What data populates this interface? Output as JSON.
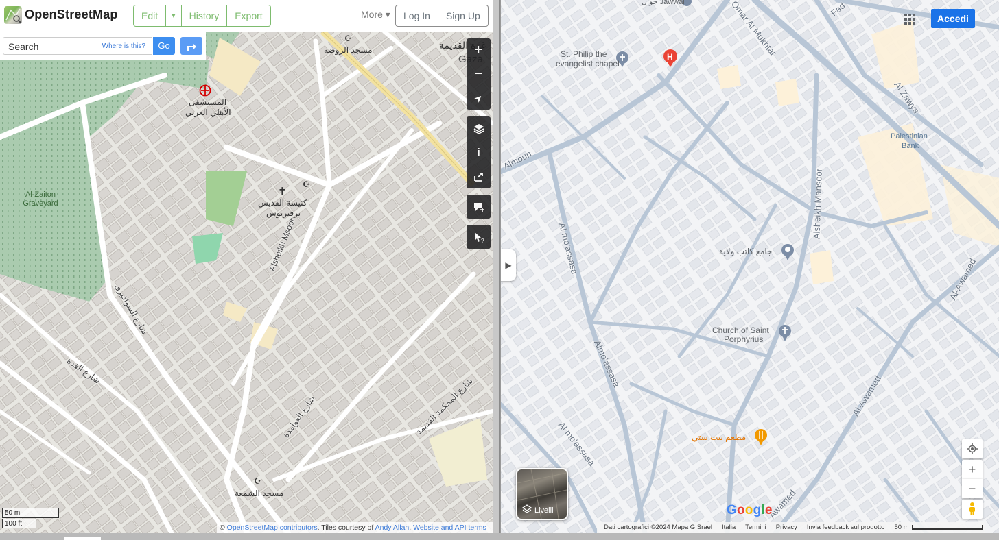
{
  "osm": {
    "brand": "OpenStreetMap",
    "nav": {
      "edit": "Edit",
      "edit_dropdown": "▾",
      "history": "History",
      "export": "Export",
      "more": "More ▾",
      "login": "Log In",
      "signup": "Sign Up"
    },
    "search": {
      "placeholder": "Search",
      "where_link": "Where is this?",
      "go": "Go"
    },
    "map_labels": {
      "mosque_rawda": "مسجد الروضة",
      "hospital_1": "المستشفى",
      "hospital_2": "الأهلي العربي",
      "church_1": "كنيسة القديس",
      "church_2": "برفيريوس",
      "graveyard": "Al-Zaiton Graveyard",
      "street_masoor": "Alsheikh Msoor",
      "street_sawarka": "شارع السوافيري",
      "street_qudda": "شارع القدة",
      "street_awamed": "شارع العوامدة",
      "street_court": "شارع المحكمة القديمة",
      "mosque_shamaa": "مسجد الشمعة",
      "gaza": "Gaza",
      "gaza_ar": "غزة القديمة"
    },
    "controls": [
      "+",
      "−",
      "➤",
      "≡",
      "i",
      "⇪",
      "✎",
      "?"
    ],
    "scale_m": "50 m",
    "scale_ft": "100 ft",
    "attribution": {
      "prefix": "©",
      "contributors": "OpenStreetMap contributors",
      "tiles": ". Tiles courtesy of",
      "author": "Andy Allan",
      "sep": ".",
      "terms": "Website and API terms"
    }
  },
  "gmap": {
    "signin": "Accedi",
    "layers_label": "Livelli",
    "logo": "Google",
    "pois": {
      "chapel_1": "St. Philip the",
      "chapel_2": "evangelist chapel",
      "jawwal": "جوال Jawwal",
      "bank_1": "Palestinian",
      "bank_2": "Bank",
      "mosque": "جامع كاتب ولاية",
      "church_1": "Church of Saint",
      "church_2": "Porphyrius",
      "restaurant": "مطعم بيت ستي"
    },
    "streets": {
      "omar": "Omar Al Mukhtar",
      "zawya": "Al Zawya",
      "mansoor": "Alsheikh Mansoor",
      "moassasa_1": "Al mo'assasa",
      "moassasa_2": "Almo'assasa",
      "moassasa_3": "Al mo'assasa",
      "awamed_1": "Al-Awamed",
      "awamed_2": "Al-Awamed",
      "awamed_3": "Awamed",
      "almoun": "Almoun",
      "fad": "Fad"
    },
    "footer": {
      "data": "Dati cartografici ©2024 Mapa GISrael",
      "country": "Italia",
      "terms": "Termini",
      "privacy": "Privacy",
      "feedback": "Invia feedback sul prodotto",
      "scale": "50 m"
    }
  },
  "colors": {
    "osm_green": "#7ebc6f",
    "google_blue": "#1a73e8",
    "park": "#add19e",
    "road_google": "#b6c4d4"
  }
}
